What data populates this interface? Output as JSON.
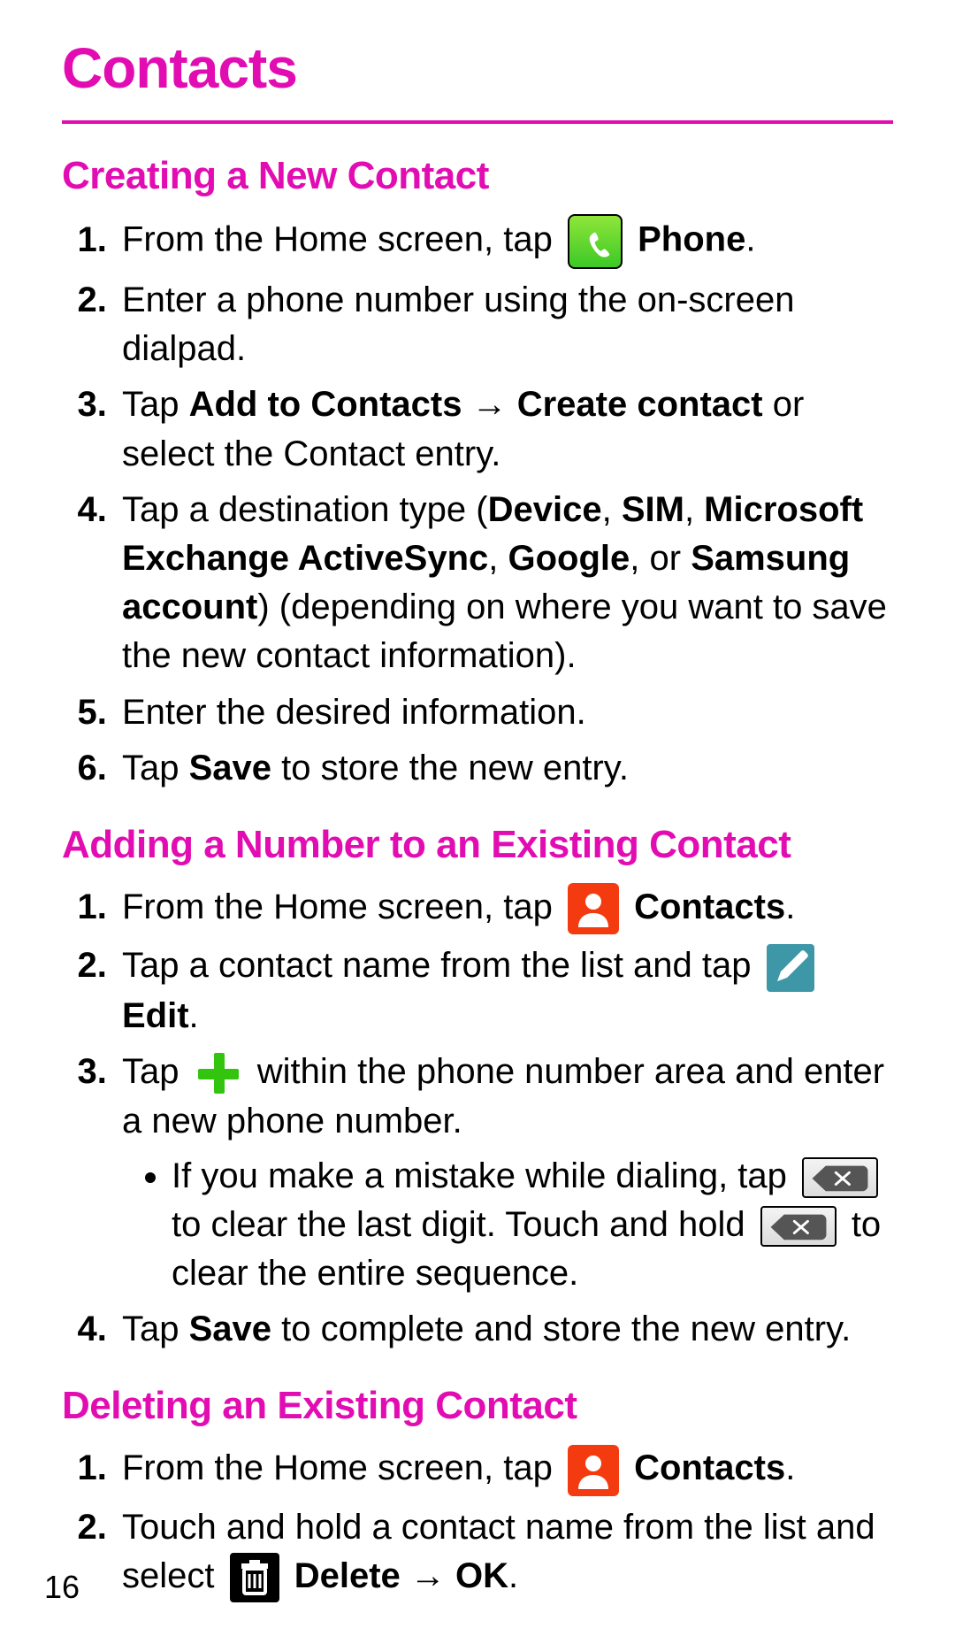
{
  "title": "Contacts",
  "page_number": "16",
  "sections": {
    "create": {
      "heading": "Creating a New Contact",
      "s1a": "From the Home screen, tap ",
      "s1b": " Phone",
      "s1c": ".",
      "s2": "Enter a phone number using the on-screen dialpad.",
      "s3a": "Tap ",
      "s3b": "Add to Contacts",
      "s3arrow": " → ",
      "s3c": "Create contact",
      "s3d": " or select the Contact entry.",
      "s4a": "Tap a destination type (",
      "s4b": "Device",
      "s4comma1": ", ",
      "s4c": "SIM",
      "s4comma2": ", ",
      "s4d": "Microsoft Exchange ActiveSync",
      "s4comma3": ", ",
      "s4e": "Google",
      "s4f": ", or ",
      "s4g": "Samsung account",
      "s4h": ") (depending on where you want to save the new contact information).",
      "s5": "Enter the desired information.",
      "s6a": "Tap ",
      "s6b": "Save",
      "s6c": " to store the new entry."
    },
    "add": {
      "heading": "Adding a Number to an Existing Contact",
      "s1a": "From the Home screen, tap ",
      "s1b": " Contacts",
      "s1c": ".",
      "s2a": "Tap a contact name from the list and tap ",
      "s2b": " Edit",
      "s2c": ".",
      "s3a": "Tap ",
      "s3b": " within the phone number area and enter a new phone number.",
      "s3_bullet_a": "If you make a mistake while dialing, tap ",
      "s3_bullet_b": " to clear the last digit. Touch and hold ",
      "s3_bullet_c": " to clear the entire sequence.",
      "s4a": "Tap ",
      "s4b": "Save",
      "s4c": " to complete and store the new entry."
    },
    "delete": {
      "heading": "Deleting an Existing Contact",
      "s1a": "From the Home screen, tap ",
      "s1b": " Contacts",
      "s1c": ".",
      "s2a": "Touch and hold a contact name from the list and select ",
      "s2b": " Delete",
      "s2arrow": " → ",
      "s2c": "OK",
      "s2d": "."
    }
  }
}
